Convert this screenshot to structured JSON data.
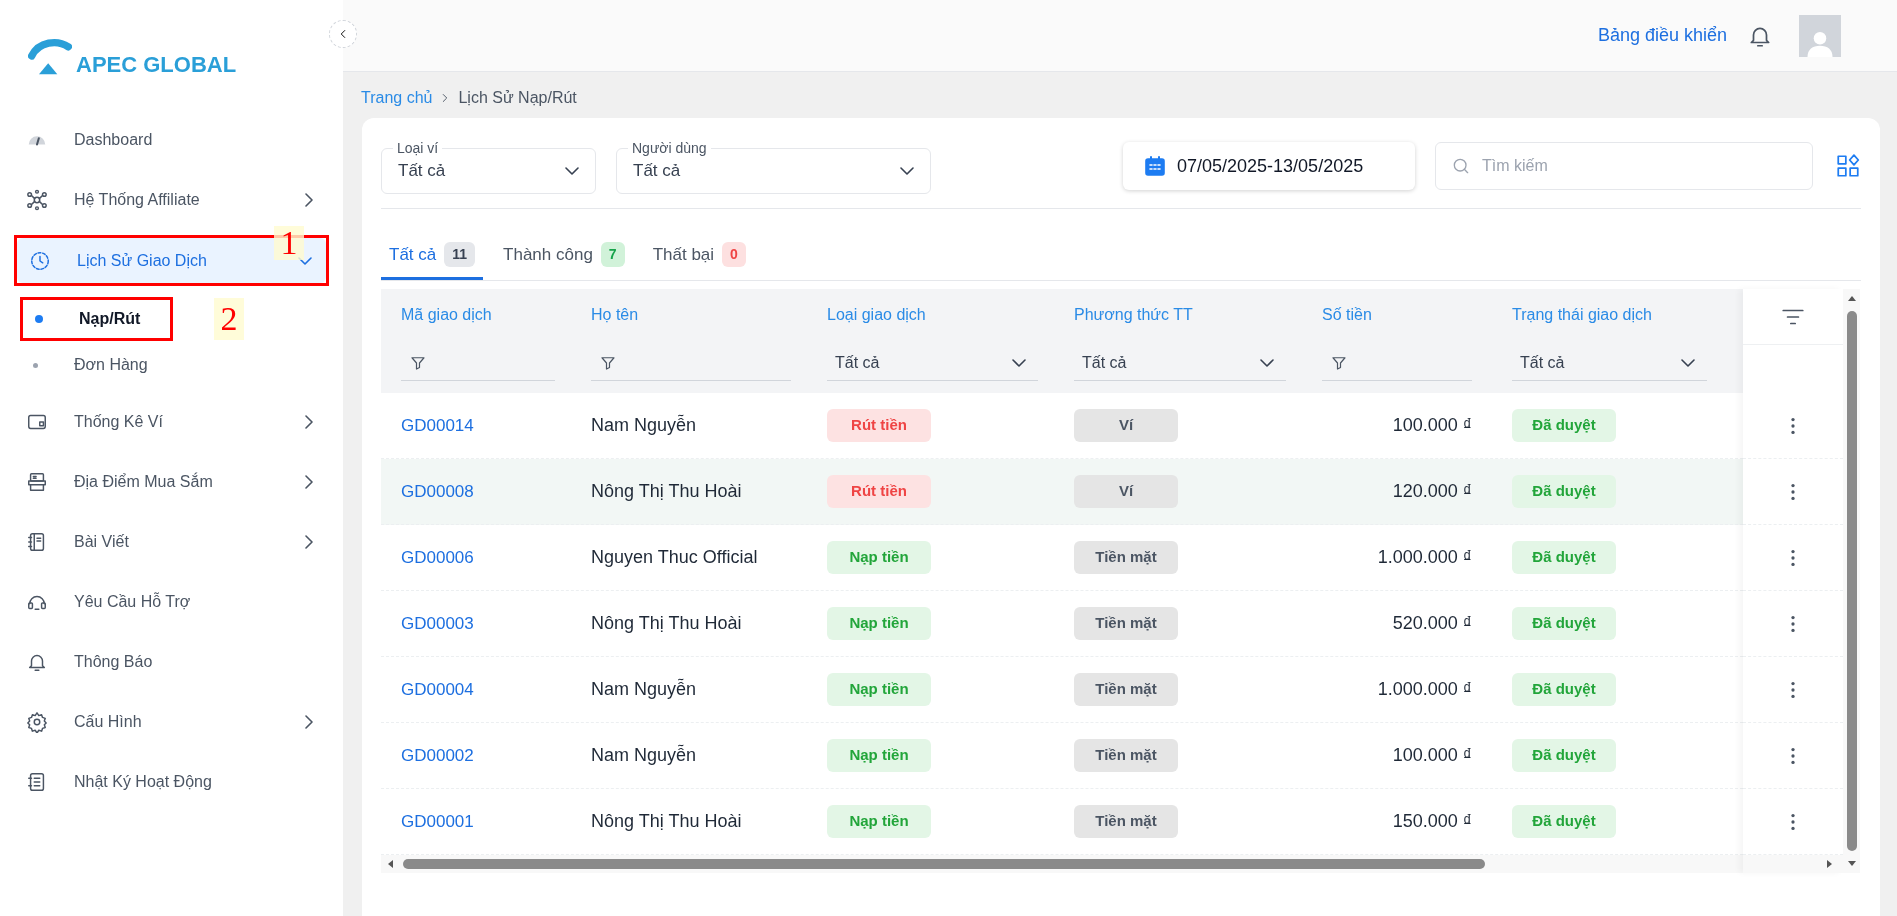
{
  "brand": {
    "name": "APEC GLOBAL"
  },
  "sidebar": {
    "items": [
      {
        "label": "Dashboard",
        "kind": "link",
        "selected": false
      },
      {
        "label": "Hệ Thống Affiliate",
        "kind": "group",
        "expanded": false,
        "selected": false
      },
      {
        "label": "Lịch Sử Giao Dịch",
        "kind": "group",
        "expanded": true,
        "selected": true,
        "children": [
          {
            "label": "Nạp/Rút",
            "selected": true
          },
          {
            "label": "Đơn Hàng",
            "selected": false
          }
        ]
      },
      {
        "label": "Thống Kê Ví",
        "kind": "group",
        "expanded": false,
        "selected": false
      },
      {
        "label": "Địa Điểm Mua Sắm",
        "kind": "group",
        "expanded": false,
        "selected": false
      },
      {
        "label": "Bài Viết",
        "kind": "group",
        "expanded": false,
        "selected": false
      },
      {
        "label": "Yêu Cầu Hỗ Trợ",
        "kind": "link",
        "selected": false
      },
      {
        "label": "Thông Báo",
        "kind": "link",
        "selected": false
      },
      {
        "label": "Cấu Hình",
        "kind": "group",
        "expanded": false,
        "selected": false
      },
      {
        "label": "Nhật Ký Hoạt Động",
        "kind": "link",
        "selected": false
      }
    ]
  },
  "header": {
    "link": "Bảng điều khiển"
  },
  "breadcrumb": [
    "Trang chủ",
    "Lịch Sử Nạp/Rút"
  ],
  "filters": [
    {
      "label": "Loại ví",
      "value": "Tất cả"
    },
    {
      "label": "Người dùng",
      "value": "Tất cả"
    }
  ],
  "date_range": "07/05/2025-13/05/2025",
  "search": {
    "placeholder": "Tìm kiếm"
  },
  "tabs": [
    {
      "label": "Tất cả",
      "count": "11",
      "kind": "neutral",
      "selected": true
    },
    {
      "label": "Thành công",
      "count": "7",
      "kind": "success",
      "selected": false
    },
    {
      "label": "Thất bại",
      "count": "0",
      "kind": "danger",
      "selected": false
    }
  ],
  "table": {
    "columns": [
      {
        "title": "Mã giao dịch",
        "kind": "text"
      },
      {
        "title": "Họ tên",
        "kind": "text"
      },
      {
        "title": "Loại giao dịch",
        "kind": "select",
        "value": "Tất cả"
      },
      {
        "title": "Phương thức TT",
        "kind": "select",
        "value": "Tất cả"
      },
      {
        "title": "Số tiền",
        "kind": "text"
      },
      {
        "title": "Trạng thái giao dịch",
        "kind": "select",
        "value": "Tất cả"
      }
    ],
    "rows": [
      {
        "id": "GD00014",
        "name": "Nam Nguyễn",
        "type": "Rút tiền",
        "kind": "withdraw",
        "method": "Ví",
        "amount": "100.000 ₫",
        "status": "Đã duyệt",
        "highlighted": false
      },
      {
        "id": "GD00008",
        "name": "Nông Thị Thu Hoài",
        "type": "Rút tiền",
        "kind": "withdraw",
        "method": "Ví",
        "amount": "120.000 ₫",
        "status": "Đã duyệt",
        "highlighted": true
      },
      {
        "id": "GD00006",
        "name": "Nguyen Thuc Official",
        "type": "Nạp tiền",
        "kind": "deposit",
        "method": "Tiền mặt",
        "amount": "1.000.000 ₫",
        "status": "Đã duyệt",
        "highlighted": false
      },
      {
        "id": "GD00003",
        "name": "Nông Thị Thu Hoài",
        "type": "Nạp tiền",
        "kind": "deposit",
        "method": "Tiền mặt",
        "amount": "520.000 ₫",
        "status": "Đã duyệt",
        "highlighted": false
      },
      {
        "id": "GD00004",
        "name": "Nam Nguyễn",
        "type": "Nạp tiền",
        "kind": "deposit",
        "method": "Tiền mặt",
        "amount": "1.000.000 ₫",
        "status": "Đã duyệt",
        "highlighted": false
      },
      {
        "id": "GD00002",
        "name": "Nam Nguyễn",
        "type": "Nạp tiền",
        "kind": "deposit",
        "method": "Tiền mặt",
        "amount": "100.000 ₫",
        "status": "Đã duyệt",
        "highlighted": false
      },
      {
        "id": "GD00001",
        "name": "Nông Thị Thu Hoài",
        "type": "Nạp tiền",
        "kind": "deposit",
        "method": "Tiền mặt",
        "amount": "150.000 ₫",
        "status": "Đã duyệt",
        "highlighted": false
      }
    ]
  },
  "annotations": [
    {
      "number": "1"
    },
    {
      "number": "2"
    }
  ]
}
